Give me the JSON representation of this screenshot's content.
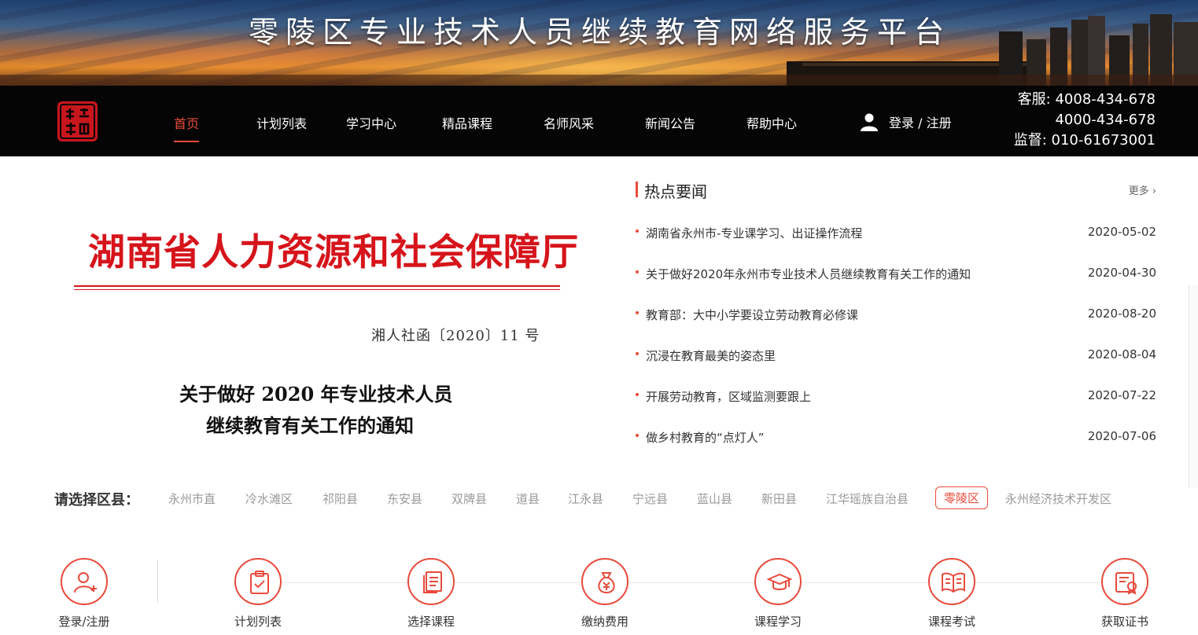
{
  "banner": {
    "title": "零陵区专业技术人员继续教育网络服务平台"
  },
  "nav": {
    "items": [
      "首页",
      "计划列表",
      "学习中心",
      "精品课程",
      "名师风采",
      "新闻公告",
      "帮助中心"
    ],
    "login_label": "登录 / 注册"
  },
  "hotline": {
    "line1": "客服: 4008-434-678",
    "line2": "4000-434-678",
    "line3": "监督: 010-61673001"
  },
  "document": {
    "org": "湖南省人力资源和社会保障厅",
    "number": "湘人社函〔2020〕11 号",
    "heading_line1": "关于做好 2020 年专业技术人员",
    "heading_line2": "继续教育有关工作的通知"
  },
  "news": {
    "title": "热点要闻",
    "more": "更多 ›",
    "items": [
      {
        "text": "湖南省永州市-专业课学习、出证操作流程",
        "date": "2020-05-02"
      },
      {
        "text": "关于做好2020年永州市专业技术人员继续教育有关工作的通知",
        "date": "2020-04-30"
      },
      {
        "text": "教育部：大中小学要设立劳动教育必修课",
        "date": "2020-08-20"
      },
      {
        "text": "沉浸在教育最美的姿态里",
        "date": "2020-08-04"
      },
      {
        "text": "开展劳动教育，区域监测要跟上",
        "date": "2020-07-22"
      },
      {
        "text": "做乡村教育的“点灯人”",
        "date": "2020-07-06"
      }
    ]
  },
  "districts": {
    "label": "请选择区县：",
    "items": [
      "永州市直",
      "冷水滩区",
      "祁阳县",
      "东安县",
      "双牌县",
      "道县",
      "江永县",
      "宁远县",
      "蓝山县",
      "新田县",
      "江华瑶族自治县",
      "零陵区",
      "永州经济技术开发区"
    ],
    "selected": "零陵区"
  },
  "steps": [
    "登录/注册",
    "计划列表",
    "选择课程",
    "缴纳费用",
    "课程学习",
    "课程考试",
    "获取证书"
  ],
  "colors": {
    "accent": "#e84b3c",
    "navbar": "#050505",
    "doc_red": "#d6141b"
  },
  "icons": [
    "user-add-icon",
    "clipboard-check-icon",
    "document-list-icon",
    "money-bag-icon",
    "graduation-cap-icon",
    "open-book-icon",
    "certificate-icon"
  ]
}
